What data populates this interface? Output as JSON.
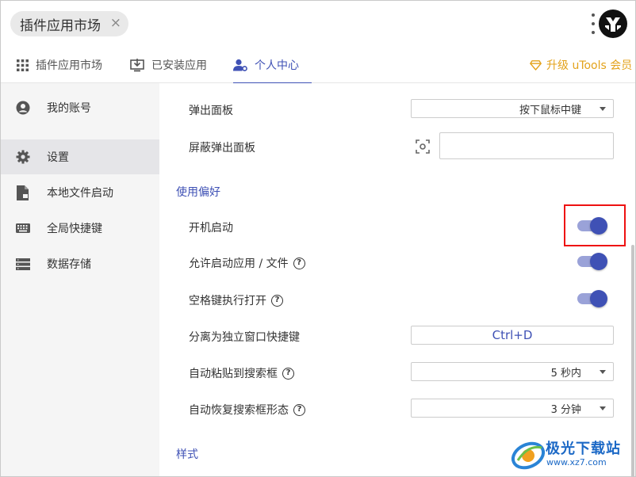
{
  "top_bar": {
    "search_chip_label": "插件应用市场",
    "close_glyph": "×"
  },
  "tabs": [
    {
      "label": "插件应用市场",
      "icon": "grid-icon"
    },
    {
      "label": "已安装应用",
      "icon": "download-monitor-icon"
    },
    {
      "label": "个人中心",
      "icon": "user-gear-icon",
      "active": true
    }
  ],
  "upgrade": {
    "label": "升级 uTools 会员",
    "icon": "diamond-icon",
    "color": "#e3a21a"
  },
  "sidebar": {
    "items": [
      {
        "label": "我的账号",
        "icon": "account-icon"
      },
      {
        "label": "设置",
        "icon": "gear-icon",
        "active": true
      },
      {
        "label": "本地文件启动",
        "icon": "file-icon"
      },
      {
        "label": "全局快捷键",
        "icon": "keyboard-icon"
      },
      {
        "label": "数据存储",
        "icon": "storage-icon"
      }
    ]
  },
  "settings": {
    "popup_panel": {
      "label": "弹出面板",
      "value": "按下鼠标中键"
    },
    "block_popup_panel": {
      "label": "屏蔽弹出面板",
      "value": ""
    },
    "section_preferences": "使用偏好",
    "autostart": {
      "label": "开机启动",
      "enabled": true
    },
    "allow_launch": {
      "label": "允许启动应用 / 文件",
      "enabled": true
    },
    "space_open": {
      "label": "空格键执行打开",
      "enabled": true
    },
    "detach_hotkey": {
      "label": "分离为独立窗口快捷键",
      "value": "Ctrl+D"
    },
    "auto_paste": {
      "label": "自动粘贴到搜索框",
      "value": "5 秒内"
    },
    "auto_restore": {
      "label": "自动恢复搜索框形态",
      "value": "3 分钟"
    },
    "section_style": "样式"
  },
  "watermark": {
    "title": "极光下载站",
    "url": "www.xz7.com"
  },
  "colors": {
    "accent": "#3f51b5",
    "highlight": "#ee1111"
  }
}
